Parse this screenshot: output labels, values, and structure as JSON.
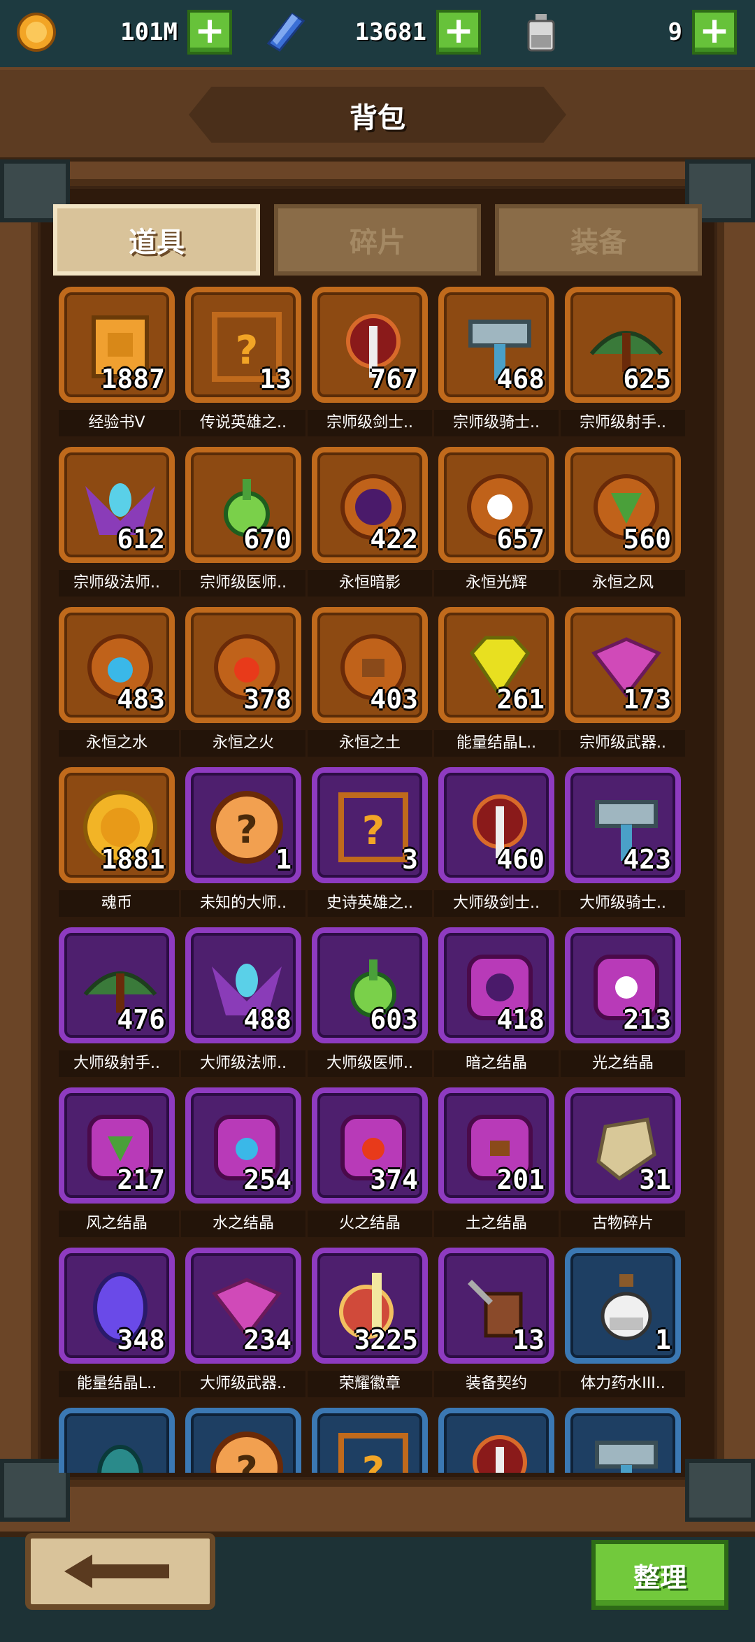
{
  "currencies": [
    {
      "icon": "gold-coin-icon",
      "value": "101M",
      "color": "#f2a526"
    },
    {
      "icon": "blue-crystal-icon",
      "value": "13681",
      "color": "#3b6fd6"
    },
    {
      "icon": "potion-bottle-icon",
      "value": "9",
      "color": "#c9c9c9"
    }
  ],
  "header": {
    "title": "背包"
  },
  "tabs": [
    {
      "label": "道具",
      "active": true
    },
    {
      "label": "碎片",
      "active": false
    },
    {
      "label": "装备",
      "active": false
    }
  ],
  "items": [
    {
      "name": "经验书V",
      "qty": "1887",
      "rarity": "orange",
      "icon": "book-icon"
    },
    {
      "name": "传说英雄之..",
      "qty": "13",
      "rarity": "orange",
      "icon": "mystery-hero-icon"
    },
    {
      "name": "宗师级剑士..",
      "qty": "767",
      "rarity": "orange",
      "icon": "sword-emblem-icon"
    },
    {
      "name": "宗师级骑士..",
      "qty": "468",
      "rarity": "orange",
      "icon": "hammer-emblem-icon"
    },
    {
      "name": "宗师级射手..",
      "qty": "625",
      "rarity": "orange",
      "icon": "bow-emblem-icon"
    },
    {
      "name": "宗师级法师..",
      "qty": "612",
      "rarity": "orange",
      "icon": "mage-wings-icon"
    },
    {
      "name": "宗师级医师..",
      "qty": "670",
      "rarity": "orange",
      "icon": "healer-flask-icon"
    },
    {
      "name": "永恒暗影",
      "qty": "422",
      "rarity": "orange",
      "icon": "moon-orb-icon"
    },
    {
      "name": "永恒光辉",
      "qty": "657",
      "rarity": "orange",
      "icon": "sun-orb-icon"
    },
    {
      "name": "永恒之风",
      "qty": "560",
      "rarity": "orange",
      "icon": "wind-orb-icon"
    },
    {
      "name": "永恒之水",
      "qty": "483",
      "rarity": "orange",
      "icon": "water-orb-icon"
    },
    {
      "name": "永恒之火",
      "qty": "378",
      "rarity": "orange",
      "icon": "fire-orb-icon"
    },
    {
      "name": "永恒之土",
      "qty": "403",
      "rarity": "orange",
      "icon": "earth-orb-icon"
    },
    {
      "name": "能量结晶L..",
      "qty": "261",
      "rarity": "orange",
      "icon": "yellow-gem-icon"
    },
    {
      "name": "宗师级武器..",
      "qty": "173",
      "rarity": "orange",
      "icon": "weapon-box-icon"
    },
    {
      "name": "魂币",
      "qty": "1881",
      "rarity": "orange",
      "icon": "soul-coin-icon"
    },
    {
      "name": "未知的大师..",
      "qty": "1",
      "rarity": "purple",
      "icon": "mystery-coin-icon"
    },
    {
      "name": "史诗英雄之..",
      "qty": "3",
      "rarity": "purple",
      "icon": "mystery-hero-icon"
    },
    {
      "name": "大师级剑士..",
      "qty": "460",
      "rarity": "purple",
      "icon": "sword-emblem-icon"
    },
    {
      "name": "大师级骑士..",
      "qty": "423",
      "rarity": "purple",
      "icon": "hammer-emblem-icon"
    },
    {
      "name": "大师级射手..",
      "qty": "476",
      "rarity": "purple",
      "icon": "bow-emblem-icon"
    },
    {
      "name": "大师级法师..",
      "qty": "488",
      "rarity": "purple",
      "icon": "mage-wings-icon"
    },
    {
      "name": "大师级医师..",
      "qty": "603",
      "rarity": "purple",
      "icon": "healer-flask-icon"
    },
    {
      "name": "暗之结晶",
      "qty": "418",
      "rarity": "purple",
      "icon": "moon-crystal-icon"
    },
    {
      "name": "光之结晶",
      "qty": "213",
      "rarity": "purple",
      "icon": "sun-crystal-icon"
    },
    {
      "name": "风之结晶",
      "qty": "217",
      "rarity": "purple",
      "icon": "wind-crystal-icon"
    },
    {
      "name": "水之结晶",
      "qty": "254",
      "rarity": "purple",
      "icon": "water-crystal-icon"
    },
    {
      "name": "火之结晶",
      "qty": "374",
      "rarity": "purple",
      "icon": "fire-crystal-icon"
    },
    {
      "name": "土之结晶",
      "qty": "201",
      "rarity": "purple",
      "icon": "earth-crystal-icon"
    },
    {
      "name": "古物碎片",
      "qty": "31",
      "rarity": "purple",
      "icon": "relic-shard-icon"
    },
    {
      "name": "能量结晶L..",
      "qty": "348",
      "rarity": "purple",
      "icon": "purple-gem-icon"
    },
    {
      "name": "大师级武器..",
      "qty": "234",
      "rarity": "purple",
      "icon": "weapon-box-icon"
    },
    {
      "name": "荣耀徽章",
      "qty": "3225",
      "rarity": "purple",
      "icon": "glory-badge-icon"
    },
    {
      "name": "装备契约",
      "qty": "13",
      "rarity": "purple",
      "icon": "equip-contract-icon"
    },
    {
      "name": "体力药水III..",
      "qty": "1",
      "rarity": "blue",
      "icon": "stamina-potion-icon"
    },
    {
      "name": "",
      "qty": "",
      "rarity": "blue",
      "icon": "mystery-hood-icon"
    },
    {
      "name": "",
      "qty": "",
      "rarity": "blue",
      "icon": "mystery-coin-icon"
    },
    {
      "name": "",
      "qty": "",
      "rarity": "blue",
      "icon": "mystery-hero-icon"
    },
    {
      "name": "",
      "qty": "",
      "rarity": "blue",
      "icon": "sword-emblem-icon"
    },
    {
      "name": "",
      "qty": "",
      "rarity": "blue",
      "icon": "hammer-emblem-icon"
    }
  ],
  "footer": {
    "sort_label": "整理",
    "back_icon": "back-arrow-icon"
  }
}
